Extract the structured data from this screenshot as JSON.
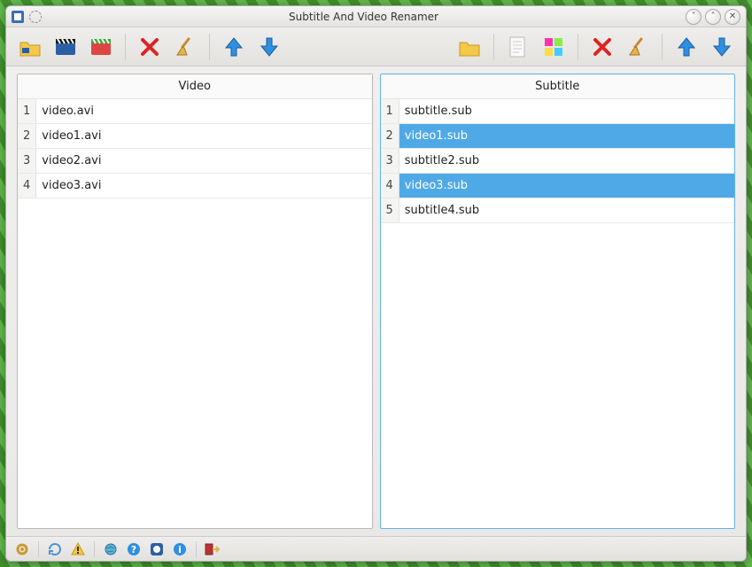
{
  "window": {
    "title": "Subtitle And Video Renamer"
  },
  "panels": {
    "video": {
      "header": "Video",
      "rows": [
        {
          "n": "1",
          "name": "video.avi",
          "selected": false
        },
        {
          "n": "2",
          "name": "video1.avi",
          "selected": false
        },
        {
          "n": "3",
          "name": "video2.avi",
          "selected": false
        },
        {
          "n": "4",
          "name": "video3.avi",
          "selected": false
        }
      ]
    },
    "subtitle": {
      "header": "Subtitle",
      "rows": [
        {
          "n": "1",
          "name": "subtitle.sub",
          "selected": false
        },
        {
          "n": "2",
          "name": "video1.sub",
          "selected": true
        },
        {
          "n": "3",
          "name": "subtitle2.sub",
          "selected": false
        },
        {
          "n": "4",
          "name": "video3.sub",
          "selected": true
        },
        {
          "n": "5",
          "name": "subtitle4.sub",
          "selected": false
        }
      ]
    }
  },
  "toolbar_left": [
    {
      "name": "open-folder-video"
    },
    {
      "name": "add-video"
    },
    {
      "name": "add-video-color"
    },
    {
      "name": "delete-video"
    },
    {
      "name": "clear-video"
    },
    {
      "name": "move-up-video"
    },
    {
      "name": "move-down-video"
    }
  ],
  "toolbar_right": [
    {
      "name": "open-folder-subtitle"
    },
    {
      "name": "add-subtitle-doc"
    },
    {
      "name": "add-subtitle-color"
    },
    {
      "name": "delete-subtitle"
    },
    {
      "name": "clear-subtitle"
    },
    {
      "name": "move-up-subtitle"
    },
    {
      "name": "move-down-subtitle"
    }
  ],
  "statusbar": [
    {
      "name": "preferences"
    },
    {
      "name": "refresh"
    },
    {
      "name": "warning"
    },
    {
      "name": "network"
    },
    {
      "name": "help"
    },
    {
      "name": "about"
    },
    {
      "name": "info"
    },
    {
      "name": "exit"
    }
  ]
}
